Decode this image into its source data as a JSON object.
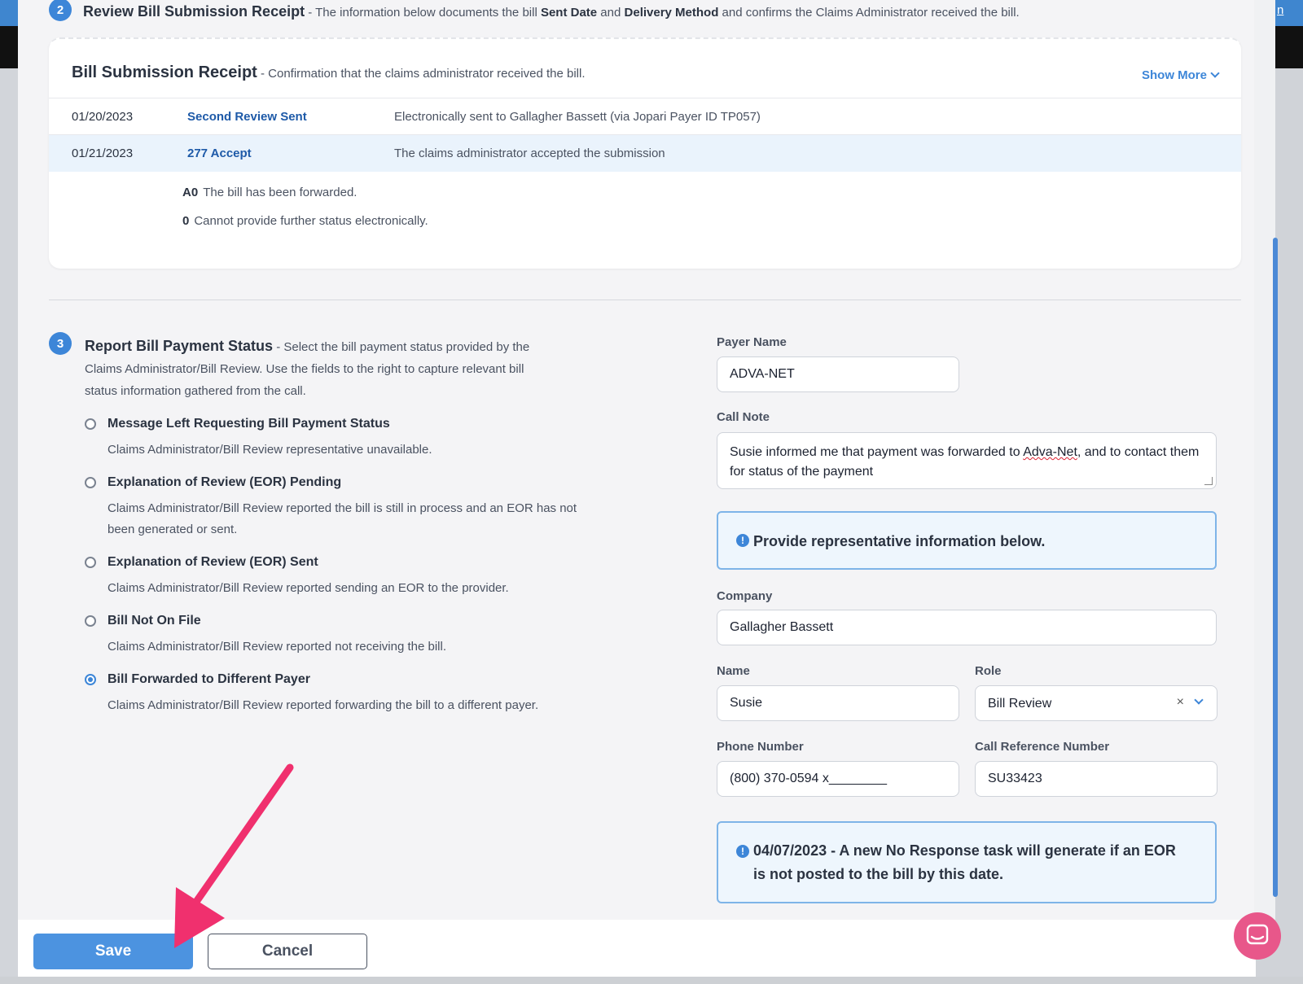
{
  "background": {
    "right_link_text": "n"
  },
  "section2": {
    "number": "2",
    "title": "Review Bill Submission Receipt",
    "desc_prefix": " - The information below documents the bill ",
    "desc_b1": "Sent Date",
    "desc_mid": " and ",
    "desc_b2": "Delivery Method",
    "desc_suffix": " and confirms the Claims Administrator received the bill."
  },
  "receipt": {
    "title": "Bill Submission Receipt",
    "subtitle": " - Confirmation that the claims administrator received the bill.",
    "show_more": "Show More",
    "rows": [
      {
        "date": "01/20/2023",
        "status": "Second Review Sent",
        "desc": "Electronically sent to Gallagher Bassett (via Jopari Payer ID TP057)"
      },
      {
        "date": "01/21/2023",
        "status": "277 Accept",
        "desc": "The claims administrator accepted the submission"
      }
    ],
    "codes": [
      {
        "code": "A0",
        "text": "The bill has been forwarded."
      },
      {
        "code": "0",
        "text": "Cannot provide further status electronically."
      }
    ]
  },
  "section3": {
    "number": "3",
    "title": "Report Bill Payment Status",
    "desc_l1": " - Select the bill payment status provided by the",
    "desc_l2": "Claims Administrator/Bill Review. Use the fields to the right to capture relevant bill",
    "desc_l3": "status information gathered from the call."
  },
  "status_options": [
    {
      "label": "Message Left Requesting Bill Payment Status",
      "help": "Claims Administrator/Bill Review representative unavailable."
    },
    {
      "label": "Explanation of Review (EOR) Pending",
      "help": "Claims Administrator/Bill Review reported the bill is still in process and an EOR has not been generated or sent."
    },
    {
      "label": "Explanation of Review (EOR) Sent",
      "help": "Claims Administrator/Bill Review reported sending an EOR to the provider."
    },
    {
      "label": "Bill Not On File",
      "help": "Claims Administrator/Bill Review reported not receiving the bill."
    },
    {
      "label": "Bill Forwarded to Different Payer",
      "help": "Claims Administrator/Bill Review reported forwarding the bill to a different payer."
    }
  ],
  "selected_option": "Bill Forwarded to Different Payer",
  "form": {
    "payer_name_label": "Payer Name",
    "payer_name_value": "ADVA-NET",
    "call_note_label": "Call Note",
    "call_note_pre": "Susie informed me that payment was forwarded to ",
    "call_note_word": "Adva-Net",
    "call_note_post": ", and to contact them for status of the payment",
    "info_text": "Provide representative information below.",
    "company_label": "Company",
    "company_value": "Gallagher Bassett",
    "name_label": "Name",
    "name_value": "Susie",
    "role_label": "Role",
    "role_value": "Bill Review",
    "phone_label": "Phone Number",
    "phone_value": "(800) 370-0594 x________",
    "callref_label": "Call Reference Number",
    "callref_value": "SU33423",
    "notice_l1": "04/07/2023 - A new No Response task will generate if an EOR",
    "notice_l2": "is not posted to the bill by this date."
  },
  "footer": {
    "save_label": "Save",
    "cancel_label": "Cancel"
  },
  "colors": {
    "accent": "#3d86d8",
    "save_button": "#4c93e0",
    "chat_button": "#e8578a",
    "annotation_arrow": "#f0306e"
  }
}
